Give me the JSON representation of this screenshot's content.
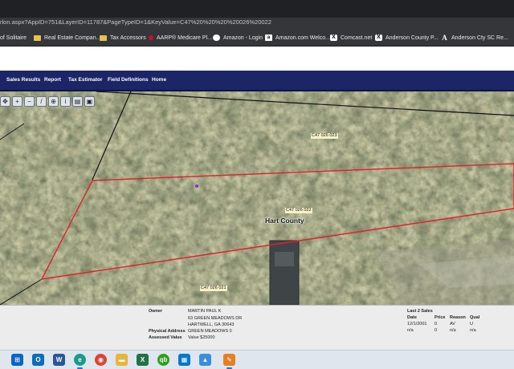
{
  "browser": {
    "url": "rlon.aspx?AppID=751&LayerID=11787&PageTypeID=1&KeyValue=C47%20%20%20%20026%20022",
    "bookmarks": [
      {
        "label": "of Solitaire",
        "icon": "none-icon"
      },
      {
        "label": "Real Estate Compan...",
        "icon": "folder-icon"
      },
      {
        "label": "Tax Accessors",
        "icon": "folder-icon"
      },
      {
        "label": "AARP® Medicare Pl...",
        "icon": "aarp-icon"
      },
      {
        "label": "Amazon - Login",
        "icon": "capitol-icon"
      },
      {
        "label": "Amazon.com Welco...",
        "icon": "amazon-icon"
      },
      {
        "label": "Comcast.net",
        "icon": "x-icon"
      },
      {
        "label": "Anderson County P...",
        "icon": "globe-icon"
      },
      {
        "label": "Anderson Cty SC Re...",
        "icon": "a-icon"
      }
    ]
  },
  "nav": {
    "items": [
      "Sales Results",
      "Report",
      "Tax Estimator",
      "Field Definitions",
      "Home"
    ]
  },
  "map": {
    "parcel_labels": [
      "C47    026 023",
      "C47    026 022",
      "C47    026 021"
    ],
    "county_label": "Hart County",
    "parcel_outline_color": "#e0212b",
    "road_color": "#1a1a1a",
    "tools": [
      "pan-icon",
      "zoom-in-icon",
      "zoom-out-icon",
      "measure-icon",
      "full-extent-icon",
      "identify-icon",
      "print-icon",
      "save-icon"
    ]
  },
  "info": {
    "owner_label": "Owner",
    "owner_lines": [
      "MARTIN PAUL K",
      "63 GREEN MEADOWS DR",
      "HARTWELL, GA 30643"
    ],
    "physical_address_label": "Physical Address",
    "physical_address": "GREEN MEADOWS 0",
    "assessed_value_label": "Assessed Value",
    "assessed_value": "Value $25000",
    "sales_title": "Last 2 Sales",
    "sales_headers": [
      "Date",
      "Price",
      "Reason",
      "Qual"
    ],
    "sales_rows": [
      [
        "12/1/2001",
        "0",
        "AV",
        "U"
      ],
      [
        "n/a",
        "0",
        "n/a",
        "n/a"
      ]
    ]
  },
  "taskbar": {
    "apps": [
      {
        "name": "start-icon",
        "color": "#0a64c8"
      },
      {
        "name": "outlook-icon",
        "color": "#0f6cbd"
      },
      {
        "name": "word-icon",
        "color": "#2b579a"
      },
      {
        "name": "edge-icon",
        "color": "#1a9c8c"
      },
      {
        "name": "chrome-icon",
        "color": "#db4437"
      },
      {
        "name": "file-explorer-icon",
        "color": "#e8b43a"
      },
      {
        "name": "excel-icon",
        "color": "#217346"
      },
      {
        "name": "quickbooks-icon",
        "color": "#2ca01c"
      },
      {
        "name": "store-icon",
        "color": "#0078d4"
      },
      {
        "name": "photos-icon",
        "color": "#3a8edc"
      },
      {
        "name": "paint-icon",
        "color": "#e67e22"
      }
    ]
  }
}
